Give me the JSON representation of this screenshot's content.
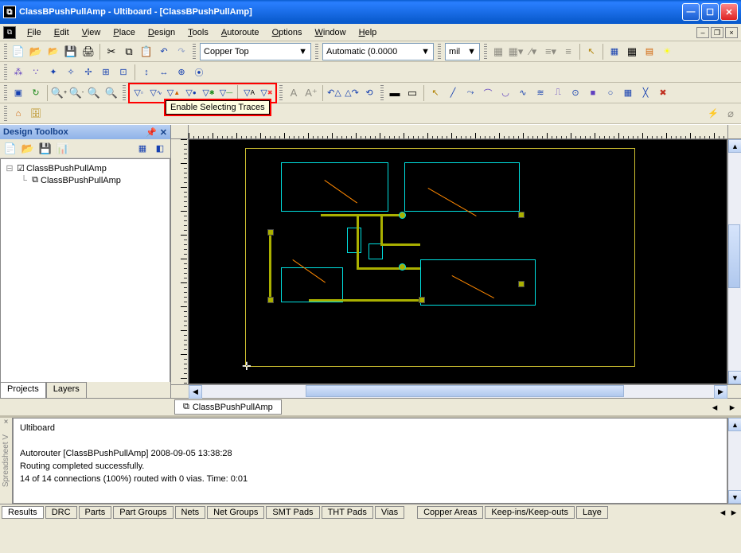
{
  "window": {
    "title": "ClassBPushPullAmp - Ultiboard - [ClassBPushPullAmp]"
  },
  "menu": {
    "items": [
      "File",
      "Edit",
      "View",
      "Place",
      "Design",
      "Tools",
      "Autoroute",
      "Options",
      "Window",
      "Help"
    ],
    "accel": [
      "F",
      "E",
      "V",
      "P",
      "D",
      "T",
      "A",
      "O",
      "W",
      "H"
    ]
  },
  "toolbar1": {
    "layer_value": "Copper Top",
    "units_mode": "Automatic (0.0000",
    "units": "mil"
  },
  "tooltip": "Enable Selecting Traces",
  "toolbox": {
    "title": "Design Toolbox",
    "tree_root": "ClassBPushPullAmp",
    "tree_child": "ClassBPushPullAmp",
    "tabs": [
      "Projects",
      "Layers"
    ],
    "active_tab": 0
  },
  "doctab": {
    "label": "ClassBPushPullAmp"
  },
  "output": {
    "side_label": "Spreadsheet V",
    "lines": [
      "Ultiboard",
      "",
      "Autorouter [ClassBPushPullAmp]  2008-09-05 13:38:28",
      "Routing completed successfully.",
      "14 of 14 connections (100%) routed with 0 vias.  Time: 0:01"
    ],
    "tabs": [
      "Results",
      "DRC",
      "Parts",
      "Part Groups",
      "Nets",
      "Net Groups",
      "SMT Pads",
      "THT Pads",
      "Vias",
      "Copper Areas",
      "Keep-ins/Keep-outs",
      "Laye"
    ],
    "active_tab": 0
  }
}
